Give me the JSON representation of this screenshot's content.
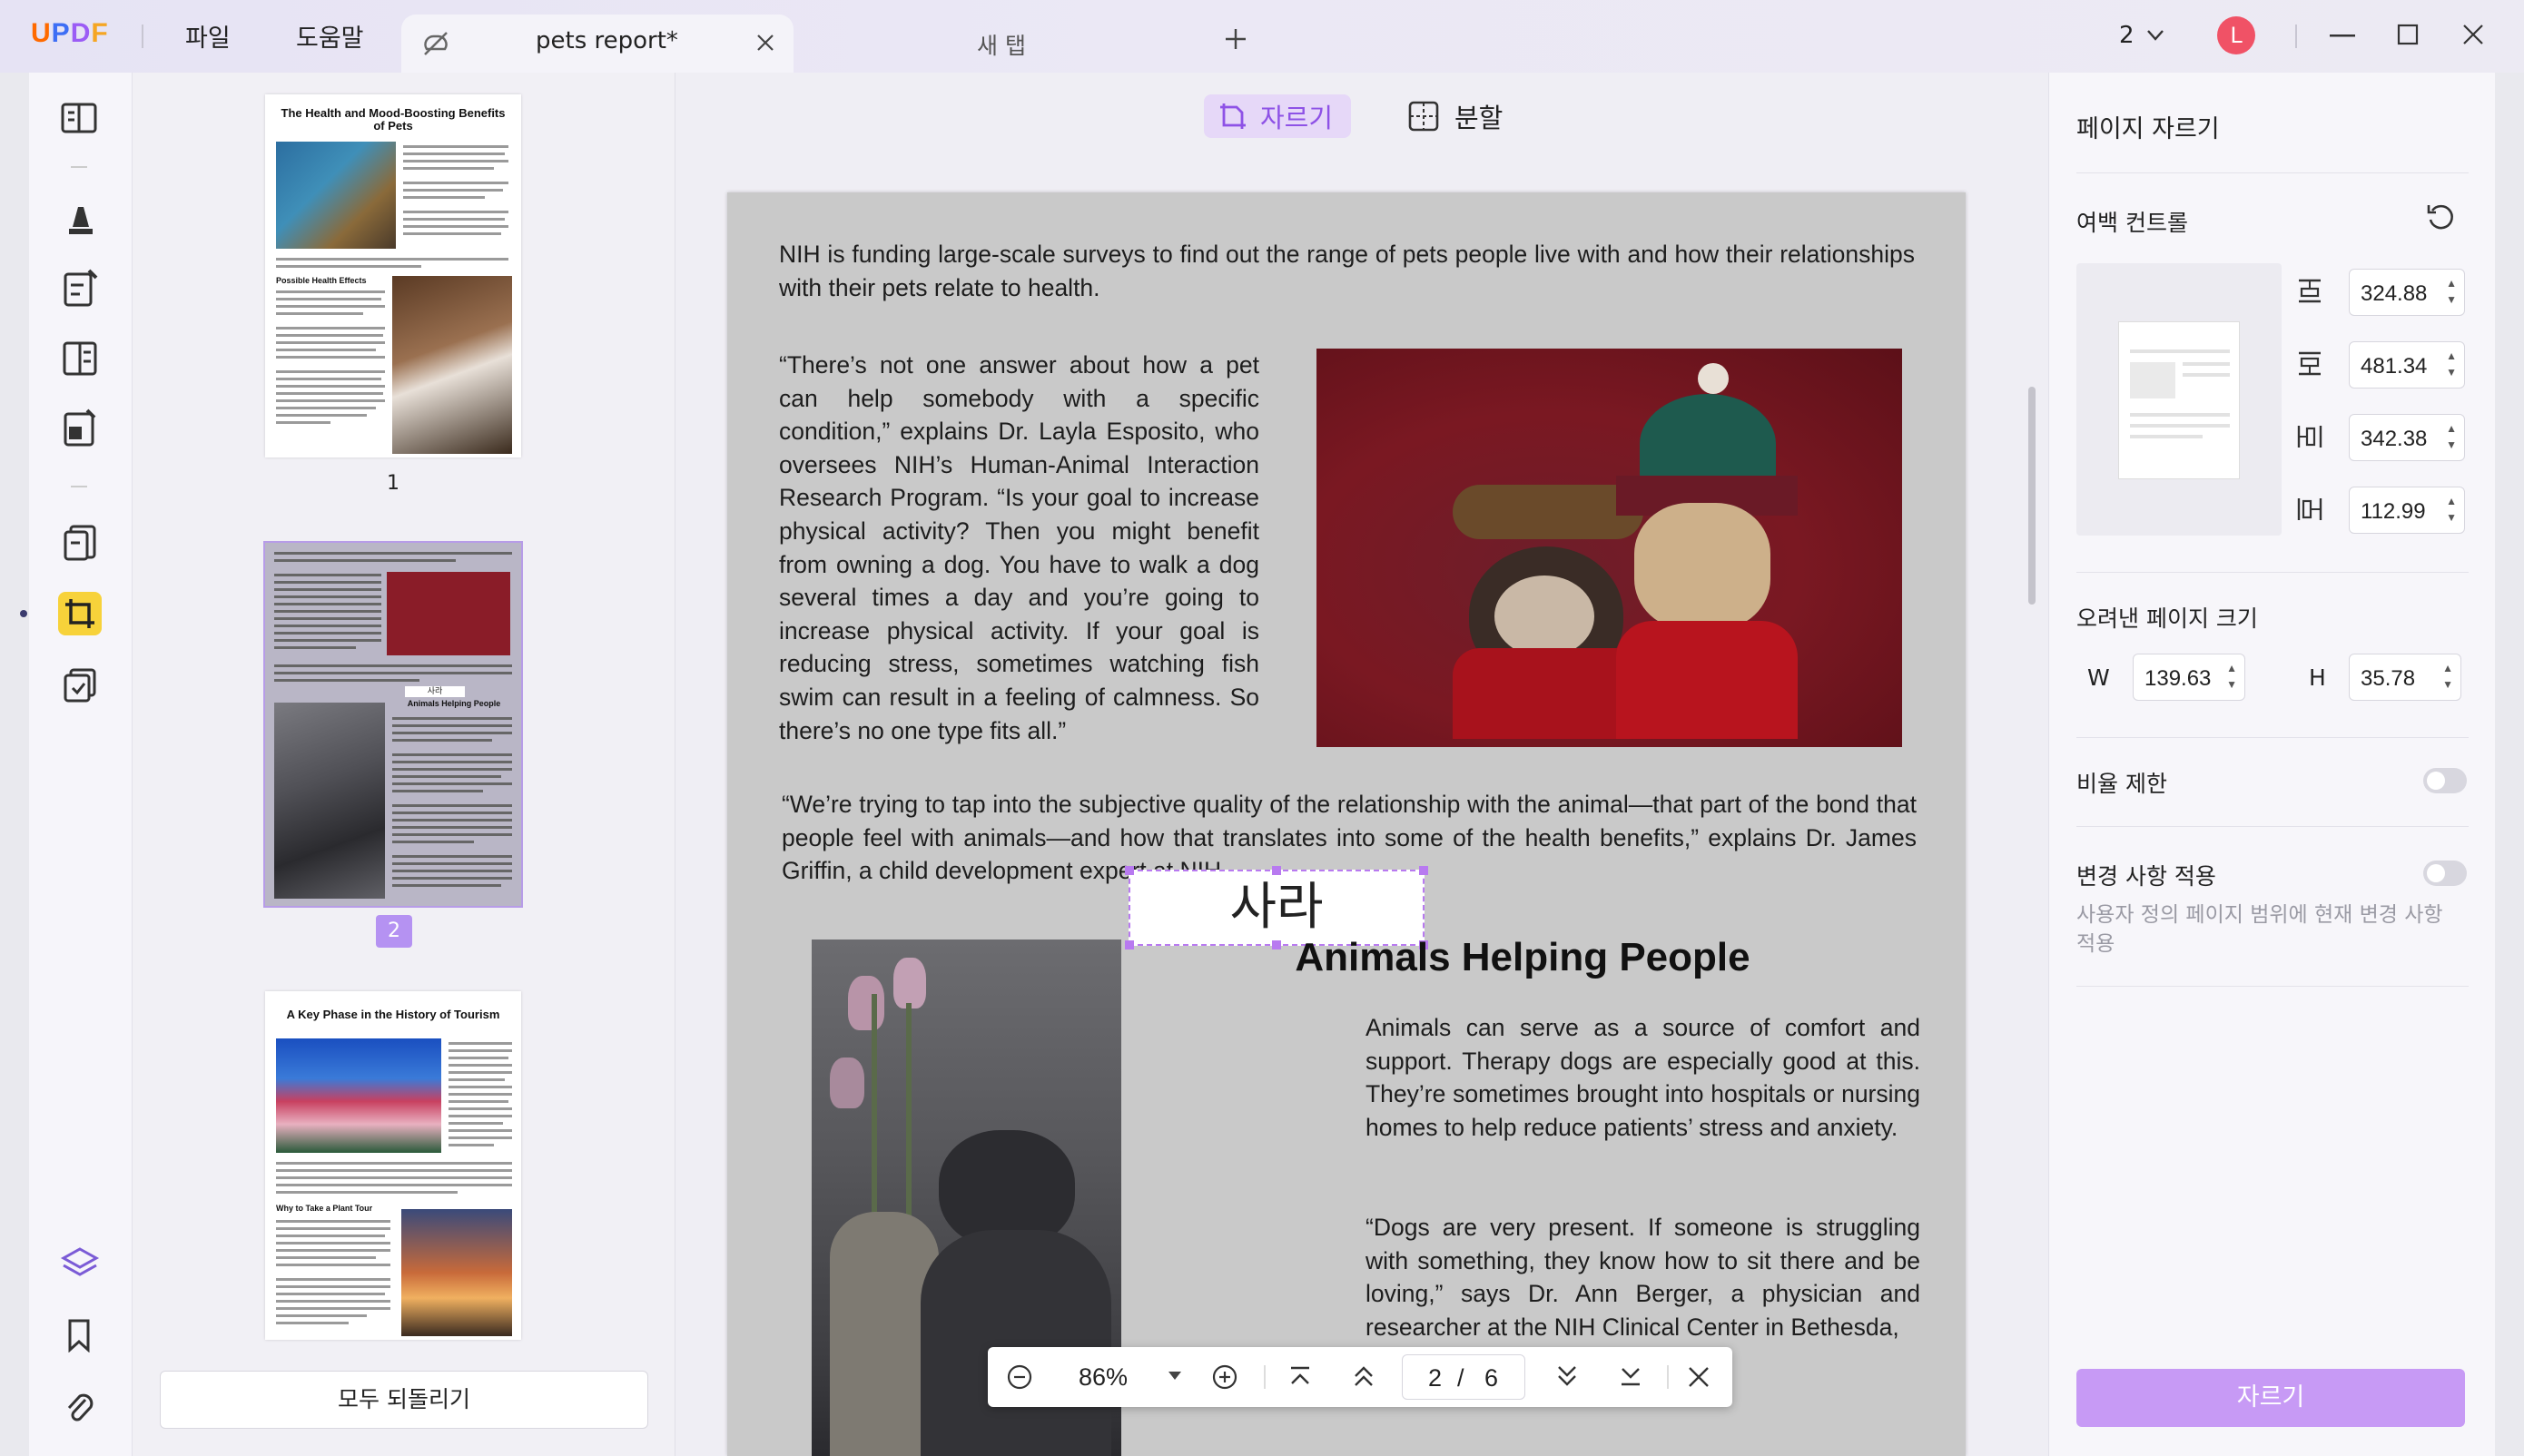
{
  "titlebar": {
    "app_name": "UPDF",
    "menu": [
      "파일",
      "도움말"
    ],
    "active_tab": "pets report*",
    "new_tab": "새 탭",
    "window_count": "2",
    "user_initial": "L"
  },
  "toolbar_modes": {
    "crop": "자르기",
    "split": "분할"
  },
  "thumbnails": [
    {
      "page": "1",
      "title": "The Health and Mood-Boosting Benefits of Pets",
      "section": "Possible Health Effects"
    },
    {
      "page": "2",
      "title": "Animals Helping People",
      "stamp": "사라"
    },
    {
      "page": "3",
      "title": "A Key Phase in the History of Tourism",
      "section": "Why to Take a Plant Tour"
    }
  ],
  "reset_all": "모두 되돌리기",
  "document": {
    "para1": "NIH is funding large-scale surveys to find out the range of pets people live with and how their relationships with their pets relate to health.",
    "para2": "“There’s not one answer about how a pet can help somebody with a specific condition,” explains Dr. Layla Esposito, who oversees NIH’s Human-Animal Interaction Research Program. “Is your goal to increase physical activity? Then you might benefit from owning a dog. You have to walk a dog several times a day and you’re going to increase physical activity. If your goal is reducing stress, sometimes watching fish swim can result in a feeling of calmness. So there’s no one type fits all.”",
    "para3": "“We’re trying to tap into the subjective quality of the relationship with the animal—that part of the bond that people feel with animals—and how that translates into some of the health benefits,” explains Dr. James Griffin, a child development expert at NIH.",
    "stamp": "사라",
    "heading": "Animals Helping People",
    "para4": "Animals can serve as a source of comfort and support. Therapy dogs are especially good at this. They’re sometimes brought into hospitals or nursing homes to help reduce patients’ stress and anxiety.",
    "para5": "“Dogs are very present. If someone is struggling with something, they know how to sit there and be loving,” says Dr. Ann Berger, a physician and researcher at the NIH Clinical Center in Bethesda,"
  },
  "navbar": {
    "zoom": "86%",
    "page_current": "2",
    "page_sep": "/",
    "page_total": "6"
  },
  "right_panel": {
    "title": "페이지 자르기",
    "margin_control": "여백 컨트롤",
    "margins": {
      "top": "324.88",
      "bottom": "481.34",
      "left": "342.38",
      "right": "112.99"
    },
    "cropped_size_label": "오려낸 페이지 크기",
    "w_label": "W",
    "w_value": "139.63",
    "h_label": "H",
    "h_value": "35.78",
    "ratio_lock": "비율 제한",
    "apply_changes": "변경 사항 적용",
    "apply_desc": "사용자 정의 페이지 범위에 현재 변경 사항 적용",
    "crop_button": "자르기",
    "accent": "#c79af5"
  }
}
